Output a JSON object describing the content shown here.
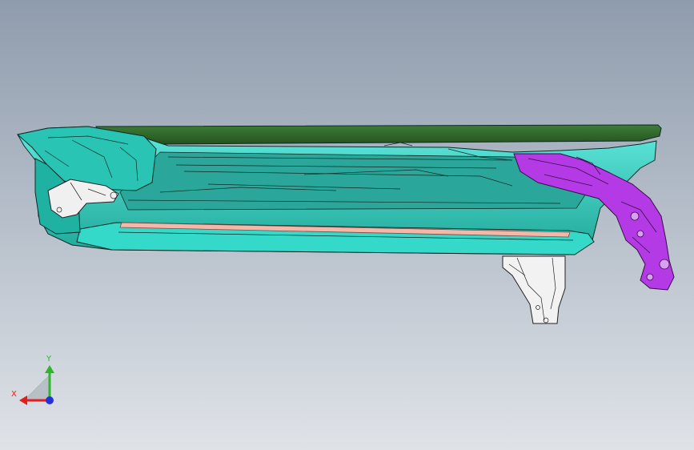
{
  "viewport": {
    "background_top": "#8f9cad",
    "background_bottom": "#dfe3e8"
  },
  "model": {
    "parts": [
      {
        "name": "top-cover-panel",
        "color": "#2f6a2b"
      },
      {
        "name": "main-frame",
        "color": "#33d6c6"
      },
      {
        "name": "left-end-housing",
        "color": "#29c4b4"
      },
      {
        "name": "linkage-arm",
        "color": "#b43ae6"
      },
      {
        "name": "mounting-bracket",
        "color": "#f2f2f2"
      },
      {
        "name": "left-bracket",
        "color": "#f0f0f0"
      },
      {
        "name": "inner-strip",
        "color": "#f4b8ab"
      }
    ],
    "edge_color": "#0e2a26"
  },
  "triad": {
    "x_label": "X",
    "y_label": "Y",
    "x_color": "#e21d1d",
    "y_color": "#2db52d",
    "z_color": "#2233d6"
  }
}
